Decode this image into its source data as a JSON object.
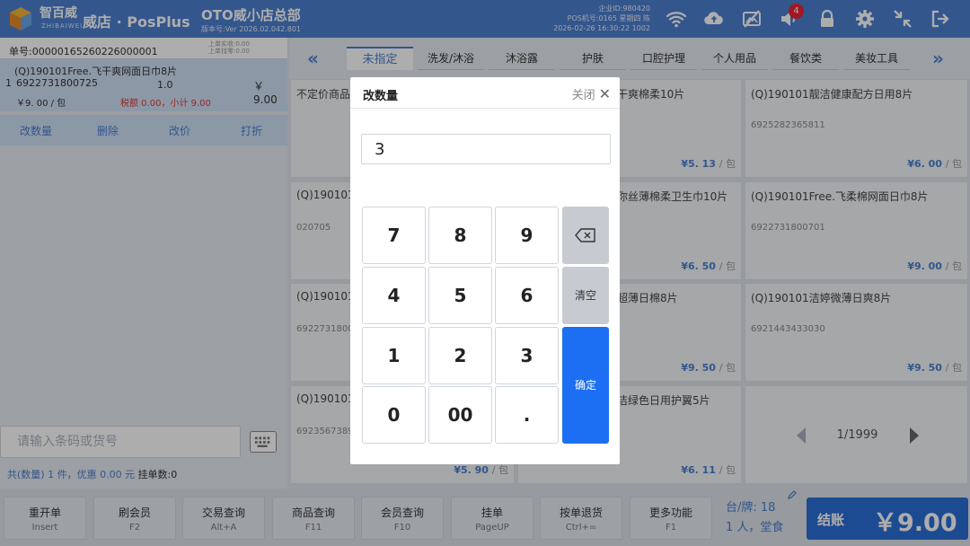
{
  "header": {
    "brand": "智百威",
    "brand_sub": "ZHIBAIWEI",
    "app_title": "威店 · PosPlus",
    "store_name": "OTO威小店总部",
    "version": "版本号:Ver 2026.02.042.801",
    "enterprise_id": "企业ID:980420",
    "pos_line": "POS机号:0165  星期四  陈",
    "datetime": "2026-02-26 16:30:22   1002",
    "notification_count": "4",
    "accent_color": "#4c7fd0",
    "icons": [
      "wifi-icon",
      "cloud-upload-icon",
      "no-image-icon",
      "speaker-icon",
      "lock-icon",
      "gear-icon",
      "collapse-icon",
      "exit-icon"
    ]
  },
  "order": {
    "order_no": "单号:00000165260226000001",
    "prev_paid": "上单实收:0.00",
    "prev_change": "上单找零:0.00",
    "item": {
      "index": "1",
      "name": "(Q)190101Free.飞干爽网面日巾8片",
      "code": "6922731800725",
      "qty": "1.0",
      "amount": "￥ 9.00",
      "unit_price": "￥9. 00 / 包",
      "tax_subtotal": "税额 0.00，小计 9.00"
    },
    "actions": [
      "改数量",
      "删除",
      "改价",
      "打折"
    ],
    "barcode_placeholder": "请输入条码或货号",
    "summary_prefix": "共(数量) 1 件，优惠 0.00 元",
    "summary_hold": "挂单数:0"
  },
  "categories": {
    "items": [
      "未指定",
      "洗发/沐浴",
      "沐浴露",
      "护肤",
      "口腔护理",
      "个人用品",
      "餐饮类",
      "美妆工具"
    ],
    "active_index": 0
  },
  "products": [
    {
      "name": "不定价商品",
      "code": "",
      "price": "",
      "unit": ""
    },
    {
      "name": "干爽棉柔10片",
      "code": "",
      "price": "¥5. 13",
      "unit": "/ 包"
    },
    {
      "name": "(Q)190101靓洁健康配方日用8片",
      "code": "6925282365811",
      "price": "¥6. 00",
      "unit": "/ 包"
    },
    {
      "name": "(Q)190101",
      "code": "020705",
      "price": "",
      "unit": ""
    },
    {
      "name": "你丝薄棉柔卫生巾10片",
      "code": "",
      "price": "¥6. 50",
      "unit": "/ 包"
    },
    {
      "name": "(Q)190101Free.飞柔棉网面日巾8片",
      "code": "6922731800701",
      "price": "¥9. 00",
      "unit": "/ 包"
    },
    {
      "name": "(Q)190101",
      "code": "69227318000",
      "price": "",
      "unit": ""
    },
    {
      "name": "超薄日棉8片",
      "code": "",
      "price": "¥9. 50",
      "unit": "/ 包"
    },
    {
      "name": "(Q)190101洁婷微薄日爽8片",
      "code": "6921443433030",
      "price": "¥9. 50",
      "unit": "/ 包"
    },
    {
      "name": "(Q)190101",
      "code": "69235673890",
      "price": "¥5. 90",
      "unit": "/ 包"
    },
    {
      "name": "洁绿色日用护翼5片",
      "code": "",
      "price": "¥6. 11",
      "unit": "/ 包"
    }
  ],
  "pager": {
    "text": "1/1999"
  },
  "bottom": {
    "buttons": [
      {
        "label": "重开单",
        "key": "Insert"
      },
      {
        "label": "刷会员",
        "key": "F2"
      },
      {
        "label": "交易查询",
        "key": "Alt+A"
      },
      {
        "label": "商品查询",
        "key": "F11"
      },
      {
        "label": "会员查询",
        "key": "F10"
      },
      {
        "label": "挂单",
        "key": "PageUP"
      },
      {
        "label": "按单退货",
        "key": "Ctrl+="
      },
      {
        "label": "更多功能",
        "key": "F1"
      }
    ],
    "table_line1": "台/牌: 18",
    "table_line2": "1 人，堂食",
    "checkout_label": "结账",
    "checkout_amount": "￥9.00"
  },
  "dialog": {
    "title": "改数量",
    "close_label": "关闭",
    "value": "3",
    "keys": [
      "7",
      "8",
      "9",
      "4",
      "5",
      "6",
      "1",
      "2",
      "3",
      "0",
      "00",
      "."
    ],
    "clear_label": "清空",
    "confirm_label": "确定"
  }
}
